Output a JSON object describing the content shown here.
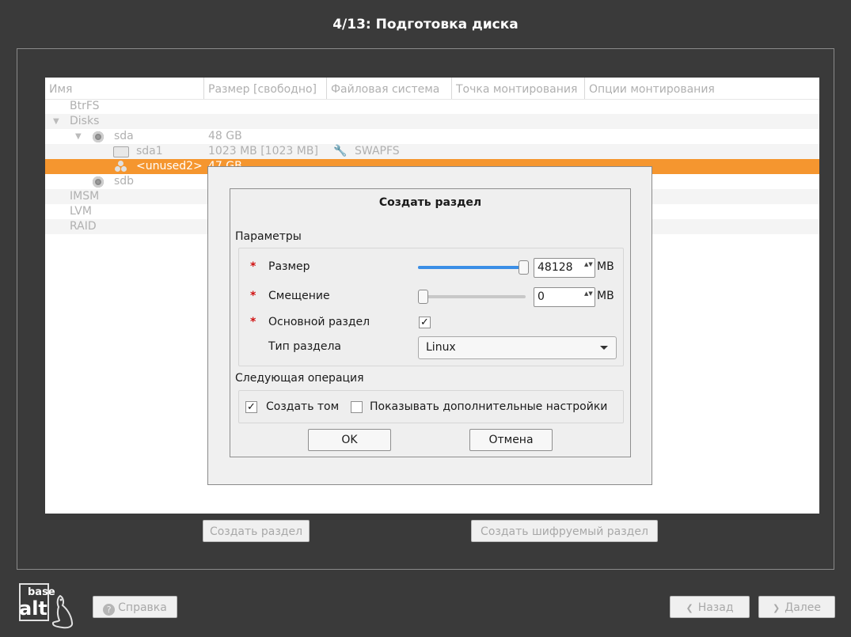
{
  "header": {
    "title": "4/13: Подготовка диска"
  },
  "tree": {
    "columns": [
      "Имя",
      "Размер [свободно]",
      "Файловая система",
      "Точка монтирования",
      "Опции монтирования"
    ],
    "rows": [
      {
        "name": "BtrFS",
        "size": "",
        "fs": ""
      },
      {
        "name": "Disks",
        "size": "",
        "fs": ""
      },
      {
        "name": "sda",
        "size": "48 GB",
        "fs": ""
      },
      {
        "name": "sda1",
        "size": "1023 MB [1023 MB]",
        "fs": "SWAPFS"
      },
      {
        "name": "<unused2>",
        "size": "47 GB",
        "fs": ""
      },
      {
        "name": "sdb",
        "size": "",
        "fs": ""
      },
      {
        "name": "IMSM",
        "size": "",
        "fs": ""
      },
      {
        "name": "LVM",
        "size": "",
        "fs": ""
      },
      {
        "name": "RAID",
        "size": "",
        "fs": ""
      }
    ]
  },
  "actions": {
    "create_partition": "Создать раздел",
    "create_encrypted_partition": "Создать шифруемый раздел"
  },
  "dialog": {
    "title": "Создать раздел",
    "params_label": "Параметры",
    "size_label": "Размер",
    "size_value": "48128",
    "size_unit": "MB",
    "size_slider_fraction": 1.0,
    "offset_label": "Смещение",
    "offset_value": "0",
    "offset_unit": "MB",
    "offset_slider_fraction": 0.0,
    "primary_label": "Основной раздел",
    "primary_checked": true,
    "type_label": "Тип раздела",
    "type_value": "Linux",
    "next_op_label": "Следующая операция",
    "create_volume_label": "Создать том",
    "create_volume_checked": true,
    "show_advanced_label": "Показывать дополнительные настройки",
    "show_advanced_checked": false,
    "ok_label": "OK",
    "cancel_label": "Отмена",
    "required_mark": "*",
    "check_mark": "✓",
    "spin_arrows": "▲▼"
  },
  "footer": {
    "logo_top": "base",
    "logo_bottom": "alt",
    "help_label": "Справка",
    "back_label": "Назад",
    "next_label": "Далее"
  },
  "colors": {
    "background": "#3a3a3a",
    "selection": "#f5962f",
    "slider_fill": "#3a8ee6",
    "required": "#d01010"
  }
}
